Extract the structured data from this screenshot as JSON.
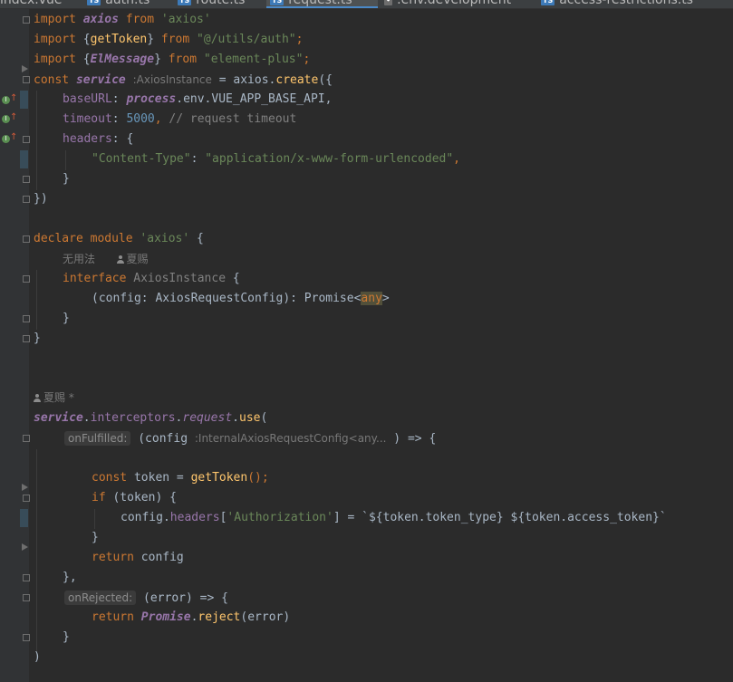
{
  "tabs": [
    {
      "name": "index.vue",
      "icon": "vue-file-icon",
      "active": false
    },
    {
      "name": "auth.ts",
      "icon": "ts-file-icon",
      "active": false
    },
    {
      "name": "route.ts",
      "icon": "ts-file-icon",
      "active": false
    },
    {
      "name": "request.ts",
      "icon": "ts-file-icon",
      "active": true
    },
    {
      "name": ".env.development",
      "icon": "env-file-icon",
      "active": false
    },
    {
      "name": "access-restrictions.ts",
      "icon": "ts-file-icon",
      "active": false
    }
  ],
  "tab_badge": "TS",
  "code": {
    "l1": {
      "kw": "import",
      "id": "axios",
      "from": "from",
      "mod": "'axios'"
    },
    "l2": {
      "kw": "import",
      "open": "{",
      "id": "getToken",
      "close": "}",
      "from": "from",
      "mod": "\"@/utils/auth\"",
      "semi": ";"
    },
    "l3": {
      "kw": "import",
      "open": "{",
      "id": "ElMessage",
      "close": "}",
      "from": "from",
      "mod": "\"element-plus\"",
      "semi": ";"
    },
    "l4": {
      "kw": "const",
      "id": "service",
      "hint": ":AxiosInstance",
      "eq": " = axios.",
      "fn": "create",
      "rest": "({"
    },
    "l5": {
      "key": "baseURL",
      "colon": ": ",
      "obj": "process",
      "rest": ".env.VUE_APP_BASE_API,"
    },
    "l6": {
      "key": "timeout",
      "colon": ": ",
      "num": "5000",
      "comma": ", ",
      "comment": "// request timeout"
    },
    "l7": {
      "key": "headers",
      "rest": ": {"
    },
    "l8": {
      "key": "\"Content-Type\"",
      "colon": ": ",
      "val": "\"application/x-www-form-urlencoded\"",
      "comma": ","
    },
    "l9": {
      "text": "}"
    },
    "l10": {
      "text": "})"
    },
    "l11": {
      "kw": "declare",
      "kw2": "module",
      "mod": "'axios'",
      "rest": " {"
    },
    "l11_hint": {
      "usage": "无用法",
      "author": "夏赐"
    },
    "l12": {
      "kw": "interface",
      "id": "AxiosInstance",
      "rest": " {"
    },
    "l13": {
      "pre": "(config: AxiosRequestConfig): Promise<",
      "any": "any",
      "post": ">"
    },
    "l14": {
      "text": "}"
    },
    "l15": {
      "text": "}"
    },
    "author_hint": {
      "author": "夏赐",
      "mark": "*"
    },
    "l16": {
      "obj": "service",
      "dot1": ".",
      "f1": "interceptors",
      "dot2": ".",
      "f2": "request",
      "dot3": ".",
      "fn": "use",
      "rest": "("
    },
    "l17": {
      "hint": "onFulfilled:",
      "pre": "(config ",
      "hint2": ":InternalAxiosRequestConfig<any...",
      "post": " ) => {"
    },
    "l18": {
      "kw": "const",
      "rest": " token = ",
      "fn": "getToken",
      "rest2": "();"
    },
    "l19": {
      "kw": "if",
      "rest": " (token) {"
    },
    "l20": {
      "pre": "config.",
      "fld": "headers",
      "open": "[",
      "str": "'Authorization'",
      "mid": "] = `${token.token_type} ${token.access_token}`"
    },
    "l21": {
      "text": "}"
    },
    "l22": {
      "kw": "return",
      "rest": " config"
    },
    "l23": {
      "pre": "},",
      "comma": ""
    },
    "l24": {
      "hint": "onRejected:",
      "rest": "(error) => {"
    },
    "l25": {
      "kw": "return",
      "obj": "Promise",
      "dot": ".",
      "fn": "reject",
      "rest": "(error)"
    },
    "l26": {
      "text": "}"
    },
    "l27": {
      "text": ")"
    }
  },
  "colors": {
    "background": "#2b2b2b",
    "keyword": "#cc7832",
    "string": "#6a8759",
    "number": "#6897bb",
    "function": "#ffc66d",
    "field": "#9876aa",
    "comment": "#808080",
    "text": "#a9b7c6"
  }
}
